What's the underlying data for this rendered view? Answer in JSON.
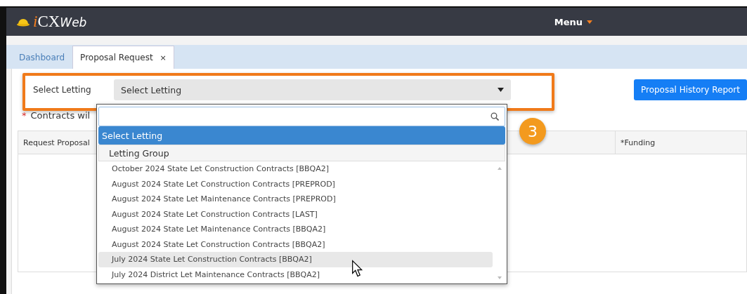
{
  "header": {
    "logo": {
      "prefix": "i",
      "main": "CX",
      "suffix": "Web"
    },
    "menu": "Menu"
  },
  "tabs": [
    {
      "label": "Dashboard",
      "selected": false,
      "closable": false
    },
    {
      "label": "Proposal Request",
      "selected": true,
      "closable": true,
      "close": "×"
    }
  ],
  "letting": {
    "label": "Select Letting",
    "value": "Select Letting"
  },
  "report_button": "Proposal History Report",
  "note": {
    "mark": "*",
    "text": "Contracts wil"
  },
  "table": {
    "columns": [
      "Request Proposal",
      "*Funding"
    ]
  },
  "dropdown": {
    "options": [
      {
        "kind": "option",
        "label": "Select Letting",
        "selected": true,
        "hovered": false
      },
      {
        "kind": "group",
        "label": "Letting Group",
        "selected": false,
        "hovered": false
      },
      {
        "kind": "item",
        "label": "October 2024 State Let Construction Contracts [BBQA2]",
        "selected": false,
        "hovered": false
      },
      {
        "kind": "item",
        "label": "August 2024 State Let Construction Contracts [PREPROD]",
        "selected": false,
        "hovered": false
      },
      {
        "kind": "item",
        "label": "August 2024 State Let Maintenance Contracts [PREPROD]",
        "selected": false,
        "hovered": false
      },
      {
        "kind": "item",
        "label": "August 2024 State Let Construction Contracts [LAST]",
        "selected": false,
        "hovered": false
      },
      {
        "kind": "item",
        "label": "August 2024 State Let Maintenance Contracts [BBQA2]",
        "selected": false,
        "hovered": false
      },
      {
        "kind": "item",
        "label": "August 2024 State Let Construction Contracts [BBQA2]",
        "selected": false,
        "hovered": false
      },
      {
        "kind": "item",
        "label": "July 2024 State Let Construction Contracts [BBQA2]",
        "selected": false,
        "hovered": true
      },
      {
        "kind": "item",
        "label": "July 2024 District Let Maintenance Contracts [BBQA2]",
        "selected": false,
        "hovered": false
      }
    ]
  },
  "step_badge": "3"
}
